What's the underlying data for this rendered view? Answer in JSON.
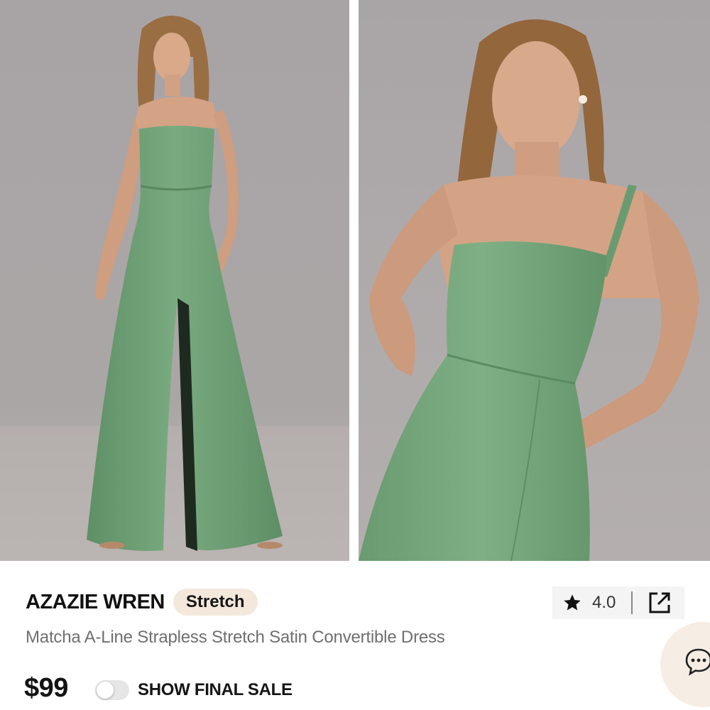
{
  "product": {
    "brand": "AZAZIE WREN",
    "tag": "Stretch",
    "name": "Matcha A-Line Strapless Stretch Satin Convertible Dress",
    "price": "$99",
    "rating": "4.0",
    "final_sale_label": "SHOW FINAL SALE",
    "final_sale_on": false
  },
  "gallery": {
    "images": [
      {
        "name": "full-length-front-view"
      },
      {
        "name": "close-up-bodice-view"
      }
    ]
  },
  "icons": {
    "rating": "star-icon",
    "share": "external-link-icon",
    "chat": "chat-bubble-icon"
  },
  "colors": {
    "dress": "#74a57a",
    "backdrop": "#a9a5a6",
    "tag_bg": "#f4e8dc",
    "chat_bg": "#f6ede4"
  }
}
